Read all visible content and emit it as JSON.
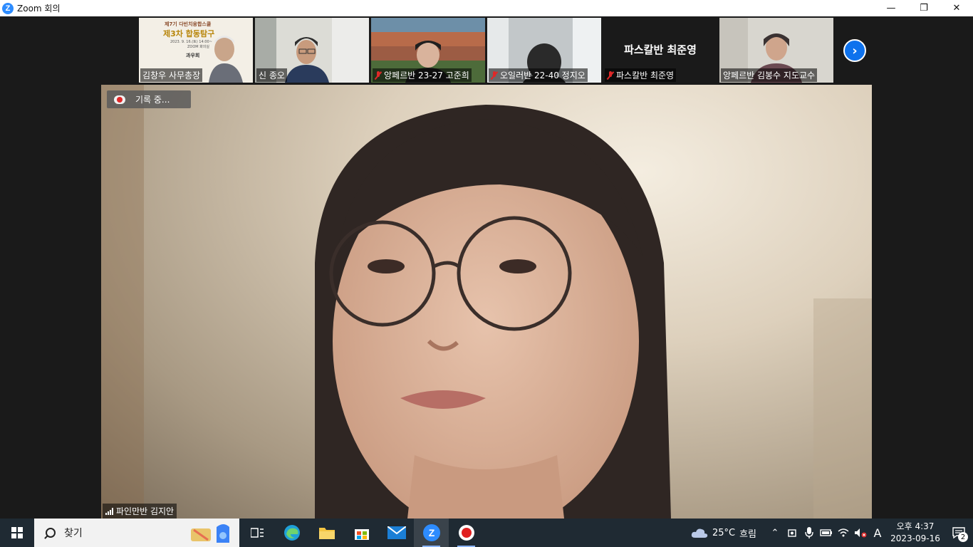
{
  "window": {
    "title": "Zoom 회의",
    "controls": {
      "minimize": "—",
      "restore": "❐",
      "close": "✕"
    }
  },
  "participants": [
    {
      "name": "김창우 사무총장",
      "muted": false,
      "active": true
    },
    {
      "name": "신 종오",
      "muted": false,
      "active": false
    },
    {
      "name": "앙페르반 23-27 고준희",
      "muted": true,
      "active": false
    },
    {
      "name": "오일러반 22-40 정지오",
      "muted": true,
      "active": false
    },
    {
      "name": "파스칼반 최준영",
      "muted": true,
      "active": false,
      "display_name": "파스칼반 최준영"
    },
    {
      "name": "앙페르반 김봉수 지도교수",
      "muted": false,
      "active": false
    }
  ],
  "poster": {
    "line1": "제7기 다빈치융합스쿨",
    "line2": "제3차 합동탐구",
    "line3": "2023. 9. 16.(토) 14:00~",
    "line4": "ZOOM 화의실",
    "line5": "과우회"
  },
  "main_video": {
    "recording_label": "기록 중...",
    "speaker_name": "파인만반 김지안"
  },
  "taskbar": {
    "search_placeholder": "찾기",
    "weather": {
      "temperature": "25°C",
      "condition": "흐림"
    },
    "clock": {
      "time": "오후 4:37",
      "date": "2023-09-16"
    },
    "ime_indicator": "A",
    "notification_count": "2"
  },
  "colors": {
    "accent": "#0e72ed",
    "active_speaker_border": "#8b6bd6",
    "muted_red": "#e02828",
    "taskbar_bg": "#1f2a33"
  }
}
